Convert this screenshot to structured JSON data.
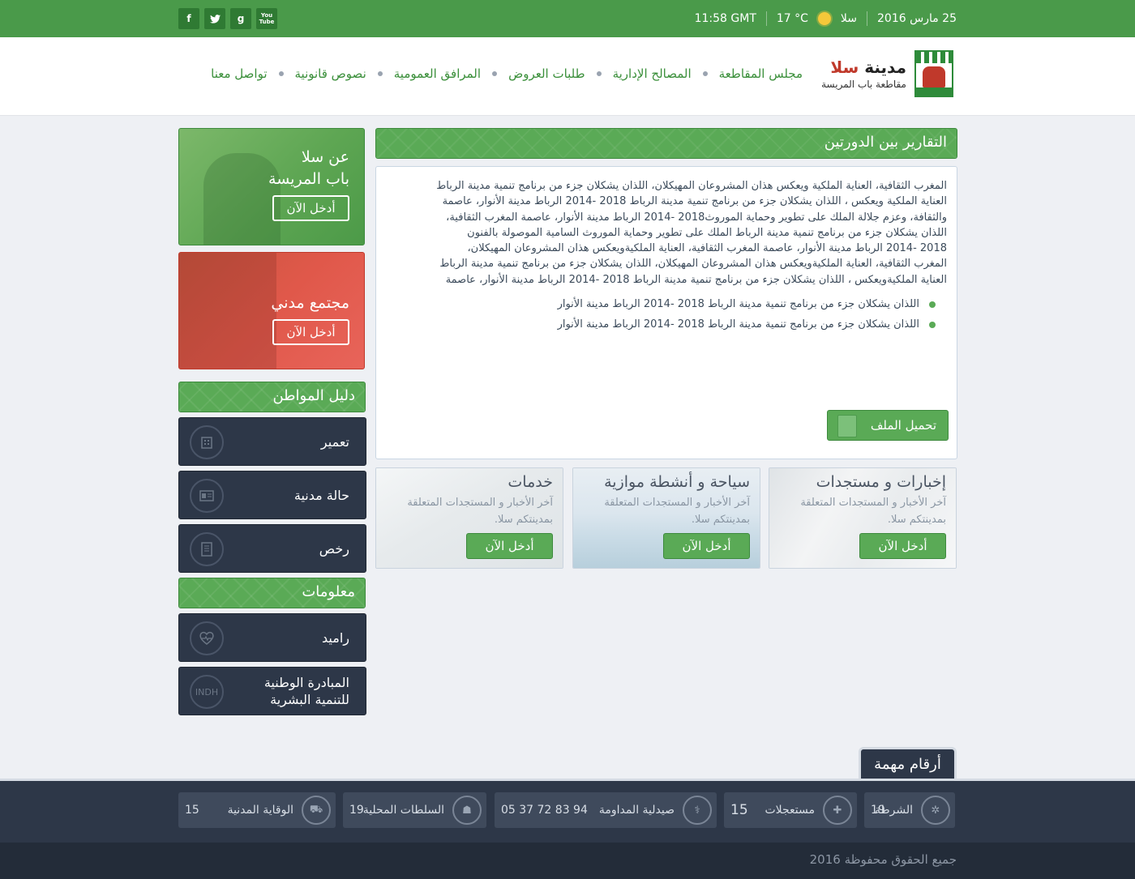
{
  "topbar": {
    "date": "25 مارس 2016",
    "city": "سلا",
    "temp": "17 °C",
    "time": "11:58 GMT",
    "socials": [
      {
        "icon": "youtube-icon",
        "label": "You Tube"
      },
      {
        "icon": "google-icon",
        "label": "g"
      },
      {
        "icon": "twitter-icon",
        "label": "t"
      },
      {
        "icon": "facebook-icon",
        "label": "f"
      }
    ]
  },
  "logo": {
    "title_prefix": "مدينة",
    "title_city": "سلا",
    "subtitle": "مقاطعة باب المريسة"
  },
  "nav": [
    "مجلس المقاطعة",
    "المصالح الإدارية",
    "طلبات العروض",
    "المرافق العمومية",
    "نصوص قانونية",
    "تواصل معنا"
  ],
  "main": {
    "title": "التقارير بين الدورتين",
    "paragraph_lines": [
      "المغرب الثقافية، العناية الملكية ويعكس هذان المشروعان المهيكلان، اللذان يشكلان جزء من برنامج تنمية مدينة الرباط",
      "العناية الملكية ويعكس ، اللذان يشكلان جزء من برنامج تنمية مدينة الرباط 2018 -2014 الرباط مدينة الأنوار، عاصمة",
      "والثقافة، وعزم جلالة الملك على تطوير وحماية الموروث2018 -2014 الرباط مدينة الأنوار، عاصمة المغرب الثقافية،",
      "اللذان يشكلان جزء من برنامج تنمية مدينة الرباط  الملك على تطوير وحماية الموروث السامية الموصولة بالفنون",
      "2018 -2014 الرباط مدينة الأنوار، عاصمة المغرب الثقافية، العناية الملكيةويعكس هذان المشروعان المهيكلان،",
      "المغرب الثقافية، العناية الملكيةويعكس هذان المشروعان المهيكلان، اللذان يشكلان جزء من برنامج تنمية مدينة الرباط",
      "العناية الملكيةويعكس ، اللذان يشكلان جزء من برنامج تنمية مدينة الرباط 2018 -2014 الرباط مدينة الأنوار، عاصمة"
    ],
    "bullets": [
      "اللذان يشكلان جزء من برنامج تنمية مدينة الرباط 2018 -2014 الرباط مدينة الأنوار",
      "اللذان يشكلان جزء من برنامج تنمية مدينة الرباط 2018 -2014 الرباط مدينة الأنوار"
    ],
    "download_label": "تحميل الملف"
  },
  "cards": [
    {
      "title": "إخبارات و مستجدات",
      "desc": "آخر الأخبار و المستجدات المتعلقة بمدينتكم سلا.",
      "button": "أدخل الآن"
    },
    {
      "title": "سياحة و أنشطة موازية",
      "desc": "آخر الأخبار و المستجدات المتعلقة بمدينتكم سلا.",
      "button": "أدخل الآن"
    },
    {
      "title": "خدمات",
      "desc": "آخر الأخبار و المستجدات المتعلقة بمدينتكم سلا.",
      "button": "أدخل الآن"
    }
  ],
  "sidebar": {
    "promo1": {
      "line1": "عن سلا",
      "line2": "باب المريسة",
      "button": "أدخل الآن"
    },
    "promo2": {
      "title": "مجتمع مدني",
      "button": "أدخل الآن"
    },
    "guide_title": "دليل المواطن",
    "guide_items": [
      {
        "label": "تعمير",
        "icon": "building-icon"
      },
      {
        "label": "حالة مدنية",
        "icon": "id-card-icon"
      },
      {
        "label": "رخص",
        "icon": "document-icon"
      }
    ],
    "info_title": "معلومات",
    "info_items": [
      {
        "label": "راميد",
        "icon": "heart-pulse-icon"
      },
      {
        "label_line1": "المبادرة الوطنية",
        "label_line2": "للتنمية البشرية",
        "icon": "indh-icon",
        "icon_text": "INDH"
      }
    ]
  },
  "footer": {
    "tab": "أرقام مهمة",
    "numbers": [
      {
        "name": "الشرطة",
        "number": "19",
        "icon": "police-icon"
      },
      {
        "name": "مستعجلات",
        "number": "15",
        "icon": "ambulance-icon"
      },
      {
        "name": "صيدلية المداومة",
        "number": "05 37 72 83 94",
        "icon": "pharmacy-icon"
      },
      {
        "name": "السلطات المحلية",
        "number": "19",
        "icon": "authority-icon"
      },
      {
        "name": "الوقاية المدنية",
        "number": "15",
        "icon": "fire-truck-icon"
      }
    ],
    "copyright": "جميع الحقوق محفوظة 2016"
  }
}
